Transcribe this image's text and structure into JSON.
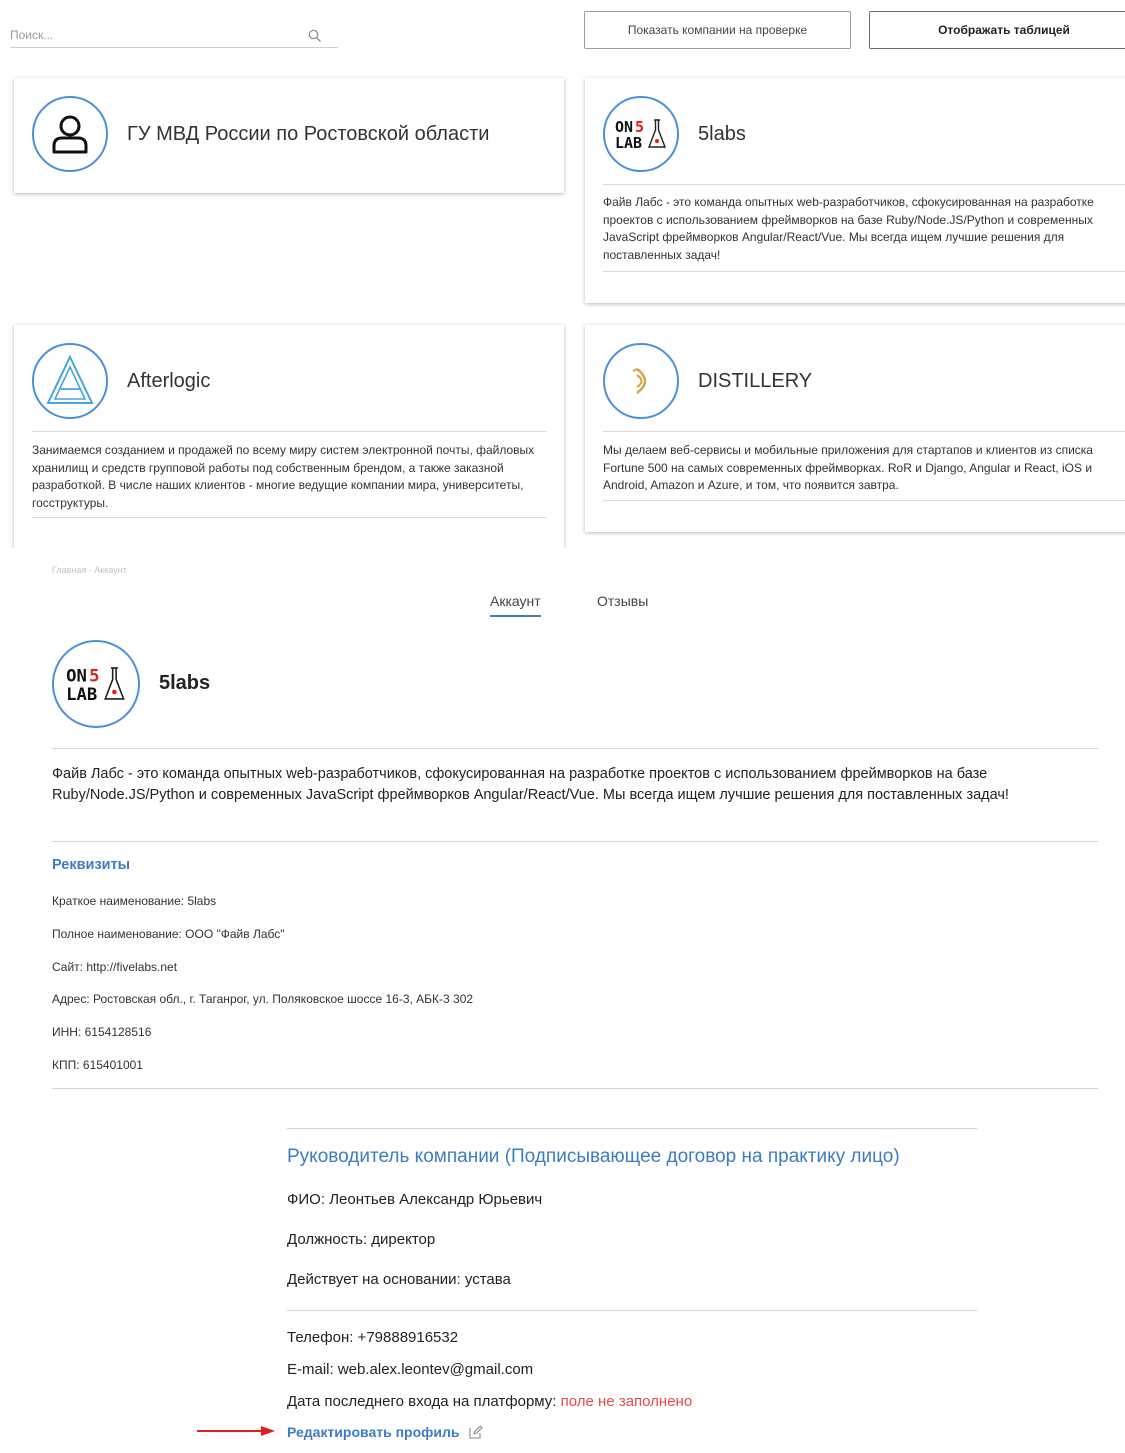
{
  "search": {
    "placeholder": "Поиск..."
  },
  "buttons": {
    "show_on_review": "Показать компании на проверке",
    "show_table": "Отображать таблицей"
  },
  "cards": [
    {
      "title": "ГУ МВД России по Ростовской области",
      "logo": "person-icon",
      "description": ""
    },
    {
      "title": "5labs",
      "logo": "5labs-logo",
      "description": "Файв Лабс - это команда опытных web-разработчиков, сфокусированная на разработке проектов с использованием фреймворков на базе Ruby/Node.JS/Python и современных JavaScript фреймворков Angular/React/Vue. Мы всегда ищем лучшие решения для поставленных задач!"
    },
    {
      "title": "Afterlogic",
      "logo": "afterlogic-logo",
      "description": "Занимаемся созданием и продажей по всему миру систем электронной почты, файловых хранилищ и средств групповой работы под собственным брендом, а также заказной разработкой. В числе наших клиентов - многие ведущие компании мира, университеты, госструктуры."
    },
    {
      "title": "DISTILLERY",
      "logo": "distillery-logo",
      "description": "Мы делаем веб-сервисы и мобильные приложения для стартапов и клиентов из списка Fortune 500 на самых современных фреймворках. RoR и Django, Angular и React, iOS и Android, Amazon и Azure, и том, что появится завтра."
    }
  ],
  "profile": {
    "breadcrumb": "Главная · Аккаунт",
    "tabs": [
      "Аккаунт",
      "Отзывы"
    ],
    "name": "5labs",
    "description": "Файв Лабс - это команда опытных web-разработчиков, сфокусированная на разработке проектов с использованием фреймворков на базе Ruby/Node.JS/Python и современных JavaScript фреймворков Angular/React/Vue. Мы всегда ищем лучшие решения для поставленных задач!",
    "requisites_title": "Реквизиты",
    "requisites": [
      "Краткое наименование: 5labs",
      "Полное наименование: ООО \"Файв Лабс\"",
      "Сайт: http://fivelabs.net",
      "Адрес: Ростовская обл., г. Таганрог, ул. Поляковское шоссе 16-3, АБК-3 302",
      "ИНН: 6154128516",
      "КПП: 615401001"
    ],
    "head_title": "Руководитель компании (Подписывающее договор на практику лицо)",
    "head_info": [
      "ФИО: Леонтьев Александр Юрьевич",
      "Должность: директор",
      "Действует на основании: устава"
    ],
    "contacts": {
      "phone": "Телефон: +79888916532",
      "email": "E-mail: web.alex.leontev@gmail.com",
      "last_login_label": "Дата последнего входа на платформу: ",
      "last_login_value": "поле не заполнено"
    },
    "edit_label": "Редактировать профиль"
  },
  "colors": {
    "accent": "#3d7cc1",
    "logo_ring": "#4a90d9",
    "warning": "#e84a4a",
    "arrow": "#e02020"
  }
}
